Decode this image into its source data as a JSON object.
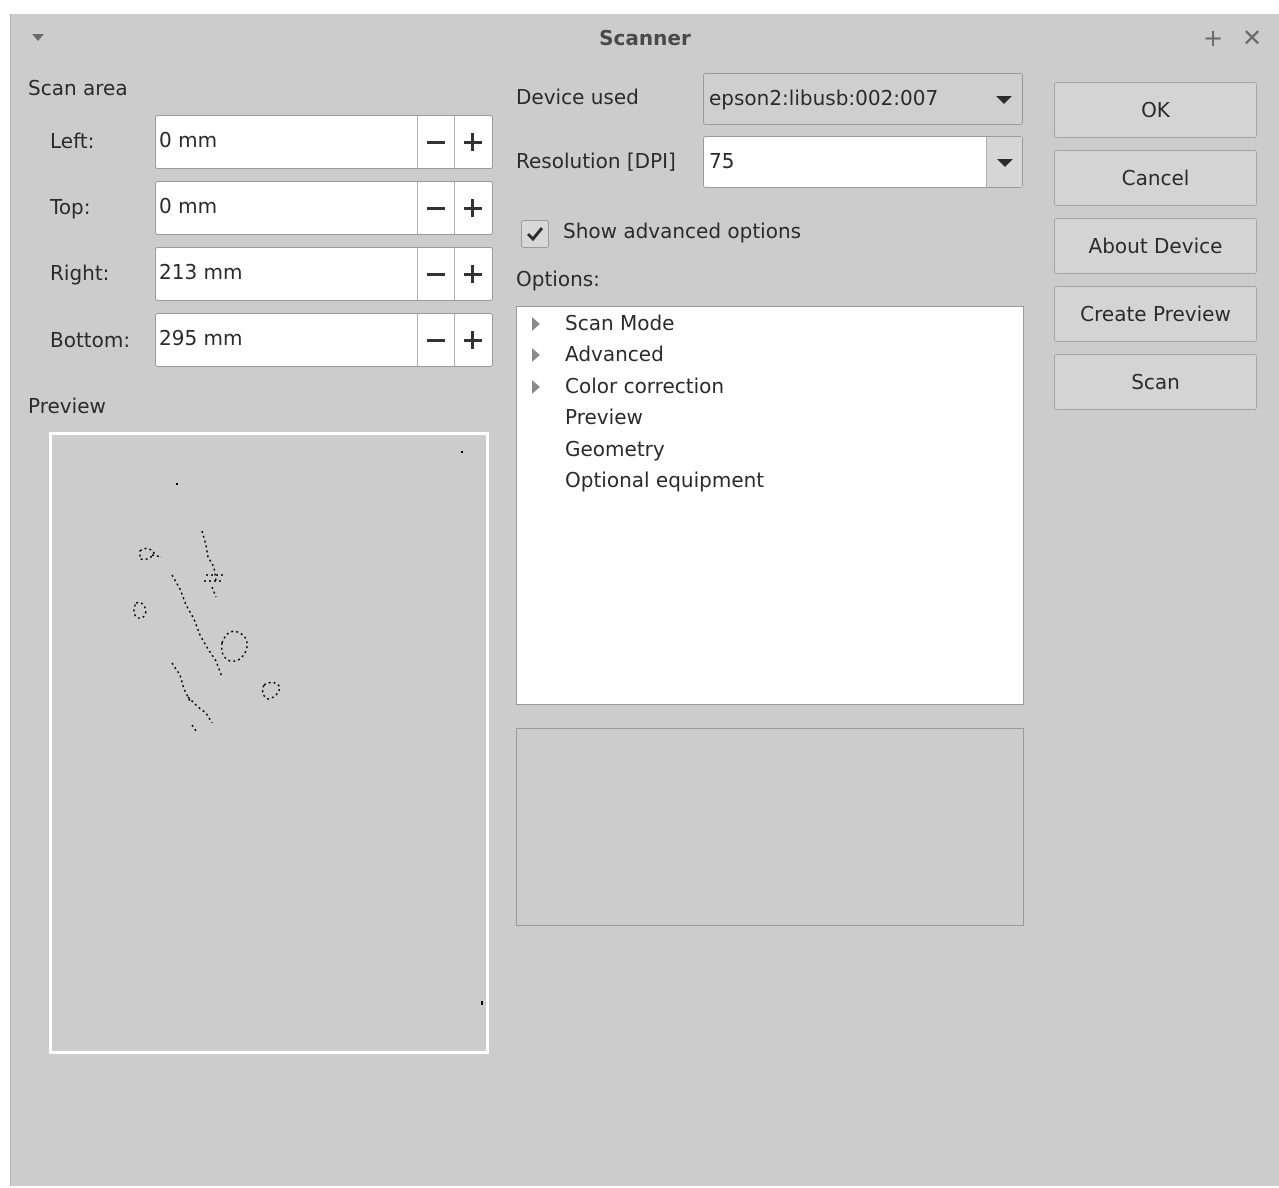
{
  "window": {
    "title": "Scanner"
  },
  "scan_area": {
    "heading": "Scan area",
    "fields": [
      {
        "label": "Left:",
        "value": "0 mm"
      },
      {
        "label": "Top:",
        "value": "0 mm"
      },
      {
        "label": "Right:",
        "value": "213 mm"
      },
      {
        "label": "Bottom:",
        "value": "295 mm"
      }
    ]
  },
  "preview": {
    "heading": "Preview"
  },
  "device": {
    "label": "Device used",
    "value": "epson2:libusb:002:007"
  },
  "resolution": {
    "label": "Resolution [DPI]",
    "value": "75"
  },
  "advanced": {
    "label": "Show advanced options",
    "checked": true
  },
  "options": {
    "label": "Options:",
    "items": [
      {
        "label": "Scan Mode",
        "expandable": true
      },
      {
        "label": "Advanced",
        "expandable": true
      },
      {
        "label": "Color correction",
        "expandable": true
      },
      {
        "label": "Preview",
        "expandable": false
      },
      {
        "label": "Geometry",
        "expandable": false
      },
      {
        "label": "Optional equipment",
        "expandable": false
      }
    ]
  },
  "buttons": {
    "ok": "OK",
    "cancel": "Cancel",
    "about": "About Device",
    "create_preview": "Create Preview",
    "scan": "Scan"
  },
  "icons": {
    "window_menu": "chevron-down-icon",
    "pin": "plus-icon",
    "close": "close-icon",
    "check": "checkmark-icon",
    "expander": "triangle-right-icon"
  }
}
